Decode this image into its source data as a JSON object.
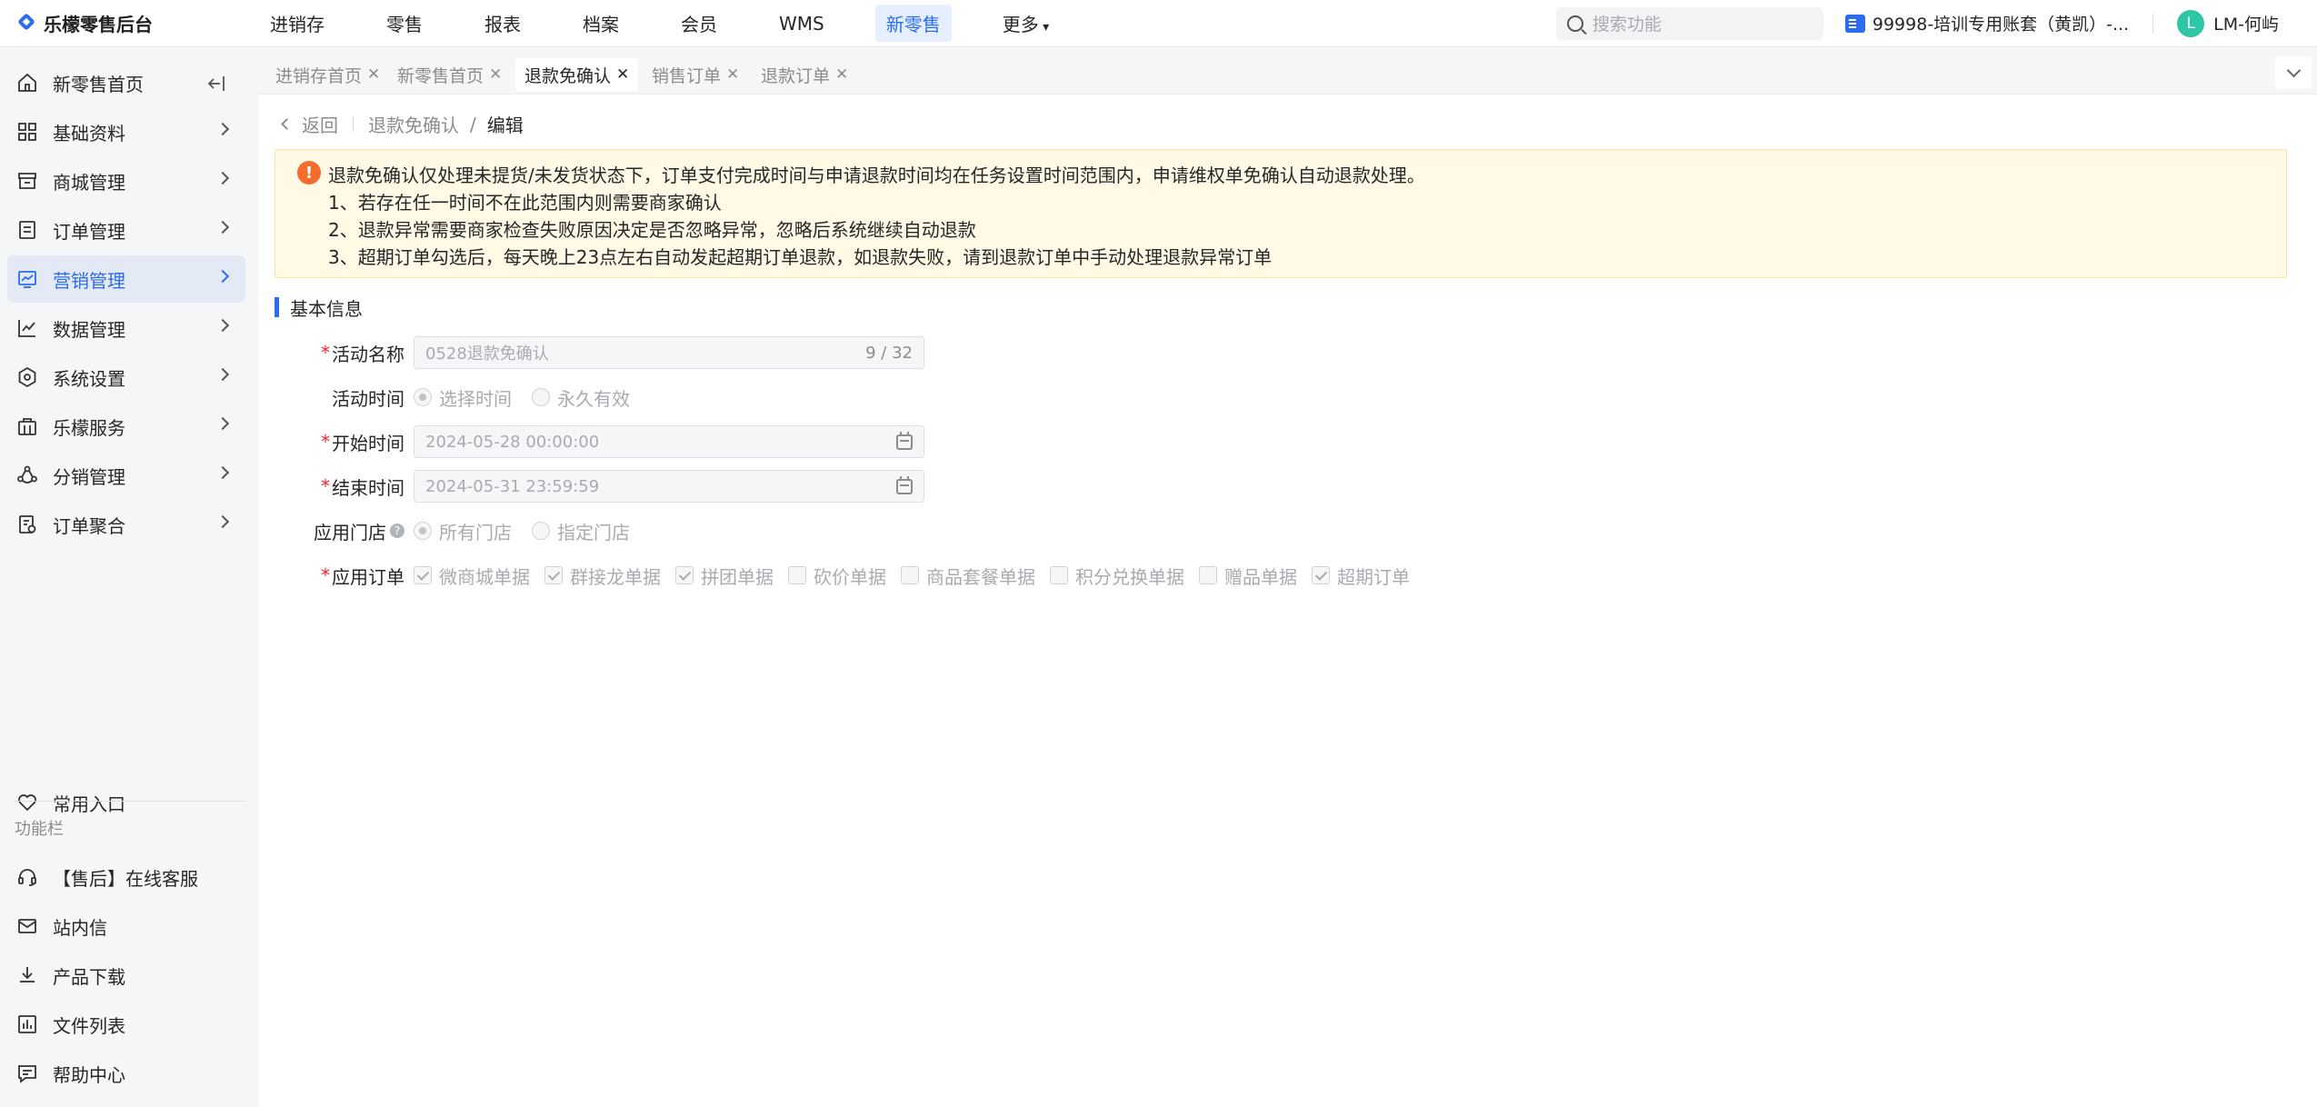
{
  "brand": {
    "name": "乐檬零售后台"
  },
  "topnav": {
    "items": [
      "进销存",
      "零售",
      "报表",
      "档案",
      "会员",
      "WMS",
      "新零售",
      "更多"
    ],
    "active": "新零售"
  },
  "search": {
    "placeholder": "搜索功能"
  },
  "account": {
    "name": "99998-培训专用账套（黄凯）-..."
  },
  "user": {
    "avatar_letter": "L",
    "name": "LM-何屿"
  },
  "sidebar": {
    "items": [
      {
        "label": "新零售首页",
        "icon": "home-icon"
      },
      {
        "label": "基础资料",
        "icon": "grid-icon"
      },
      {
        "label": "商城管理",
        "icon": "store-icon"
      },
      {
        "label": "订单管理",
        "icon": "order-icon"
      },
      {
        "label": "营销管理",
        "icon": "marketing-icon"
      },
      {
        "label": "数据管理",
        "icon": "chart-icon"
      },
      {
        "label": "系统设置",
        "icon": "settings-icon"
      },
      {
        "label": "乐檬服务",
        "icon": "service-icon"
      },
      {
        "label": "分销管理",
        "icon": "distribution-icon"
      },
      {
        "label": "订单聚合",
        "icon": "order-aggregate-icon"
      }
    ],
    "active": "营销管理",
    "favorites": "常用入口",
    "caption": "功能栏",
    "tools": [
      {
        "label": "【售后】在线客服",
        "icon": "headset-icon"
      },
      {
        "label": "站内信",
        "icon": "mail-icon"
      },
      {
        "label": "产品下载",
        "icon": "download-icon"
      },
      {
        "label": "文件列表",
        "icon": "file-list-icon"
      },
      {
        "label": "帮助中心",
        "icon": "help-icon"
      }
    ]
  },
  "tabs": [
    {
      "label": "进销存首页",
      "active": false
    },
    {
      "label": "新零售首页",
      "active": false
    },
    {
      "label": "退款免确认",
      "active": true
    },
    {
      "label": "销售订单",
      "active": false
    },
    {
      "label": "退款订单",
      "active": false
    }
  ],
  "breadcrumb": {
    "back": "返回",
    "parent": "退款免确认",
    "separator": "/",
    "current": "编辑"
  },
  "notice": {
    "lines": [
      "退款免确认仅处理未提货/未发货状态下，订单支付完成时间与申请退款时间均在任务设置时间范围内，申请维权单免确认自动退款处理。",
      "1、若存在任一时间不在此范围内则需要商家确认",
      "2、退款异常需要商家检查失败原因决定是否忽略异常，忽略后系统继续自动退款",
      "3、超期订单勾选后，每天晚上23点左右自动发起超期订单退款，如退款失败，请到退款订单中手动处理退款异常订单"
    ]
  },
  "form": {
    "section_title": "基本信息",
    "required_mark": "*",
    "name": {
      "label": "活动名称",
      "value": "0528退款免确认",
      "count": "9 / 32"
    },
    "time_type": {
      "label": "活动时间",
      "options": [
        "选择时间",
        "永久有效"
      ],
      "selected": "选择时间"
    },
    "start": {
      "label": "开始时间",
      "value": "2024-05-28 00:00:00"
    },
    "end": {
      "label": "结束时间",
      "value": "2024-05-31 23:59:59"
    },
    "stores": {
      "label": "应用门店",
      "help": "?",
      "options": [
        "所有门店",
        "指定门店"
      ],
      "selected": "所有门店"
    },
    "orders": {
      "label": "应用订单",
      "options": [
        {
          "label": "微商城单据",
          "checked": true
        },
        {
          "label": "群接龙单据",
          "checked": true
        },
        {
          "label": "拼团单据",
          "checked": true
        },
        {
          "label": "砍价单据",
          "checked": false
        },
        {
          "label": "商品套餐单据",
          "checked": false
        },
        {
          "label": "积分兑换单据",
          "checked": false
        },
        {
          "label": "赠品单据",
          "checked": false
        },
        {
          "label": "超期订单",
          "checked": true
        }
      ]
    }
  },
  "colors": {
    "accent": "#2b6cf0",
    "warning": "#f56c2c",
    "notice_bg": "#fff9e6",
    "required": "#f5222d"
  }
}
